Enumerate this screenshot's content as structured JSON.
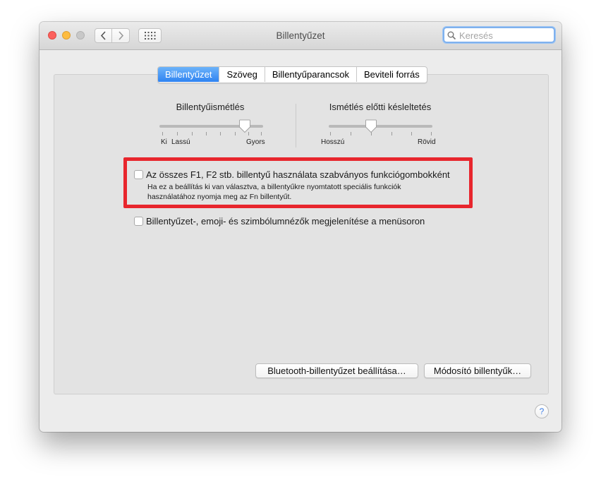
{
  "window": {
    "title": "Billentyűzet",
    "search_placeholder": "Keresés"
  },
  "tabs": [
    {
      "label": "Billentyűzet",
      "active": true
    },
    {
      "label": "Szöveg",
      "active": false
    },
    {
      "label": "Billentyűparancsok",
      "active": false
    },
    {
      "label": "Beviteli forrás",
      "active": false
    }
  ],
  "key_repeat": {
    "title": "Billentyűismétlés",
    "label_off": "Ki",
    "label_slow": "Lassú",
    "label_fast": "Gyors"
  },
  "delay_until_repeat": {
    "title": "Ismétlés előtti késleltetés",
    "label_long": "Hosszú",
    "label_short": "Rövid"
  },
  "fn_keys": {
    "label": "Az összes F1, F2 stb. billentyű használata szabványos funkciógombokként",
    "description_line1": "Ha ez a beállítás ki van választva, a billentyűkre nyomtatott speciális funkciók",
    "description_line2": "használatához nyomja meg az Fn billentyűt.",
    "checked": false
  },
  "show_viewers": {
    "label": "Billentyűzet-, emoji- és szimbólumnézők megjelenítése a menüsoron",
    "checked": false
  },
  "buttons": {
    "bluetooth": "Bluetooth-billentyűzet beállítása…",
    "modifier": "Módosító billentyűk…",
    "help": "?"
  },
  "colors": {
    "accent": "#3b8af5",
    "highlight_border": "#e8262d"
  }
}
